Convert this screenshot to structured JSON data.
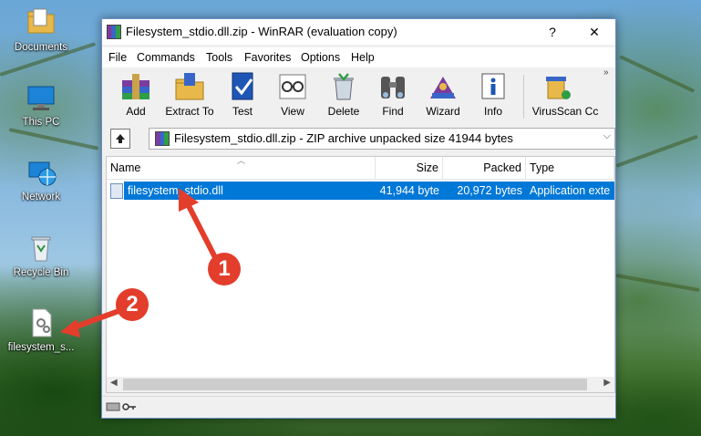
{
  "desktop": {
    "icons": [
      {
        "label": "Documents",
        "icon": "folder-icon"
      },
      {
        "label": "This PC",
        "icon": "monitor-icon"
      },
      {
        "label": "Network",
        "icon": "network-globe-icon"
      },
      {
        "label": "Recycle Bin",
        "icon": "recycle-bin-icon"
      },
      {
        "label": "filesystem_s...",
        "icon": "dll-file-icon"
      }
    ]
  },
  "window": {
    "title": "Filesystem_stdio.dll.zip - WinRAR (evaluation copy)",
    "help_button": "?",
    "close_button": "✕"
  },
  "menu": [
    "File",
    "Commands",
    "Tools",
    "Favorites",
    "Options",
    "Help"
  ],
  "toolbar": {
    "buttons": [
      {
        "label": "Add",
        "icon": "books-add-icon"
      },
      {
        "label": "Extract To",
        "icon": "folder-extract-icon"
      },
      {
        "label": "Test",
        "icon": "test-check-icon"
      },
      {
        "label": "View",
        "icon": "glasses-book-icon"
      },
      {
        "label": "Delete",
        "icon": "delete-bin-icon"
      },
      {
        "label": "Find",
        "icon": "binoculars-icon"
      },
      {
        "label": "Wizard",
        "icon": "wizard-icon"
      },
      {
        "label": "Info",
        "icon": "info-icon"
      },
      {
        "label": "VirusScan",
        "icon": "virusscan-icon"
      },
      {
        "label": "Cc",
        "icon": "comment-icon"
      }
    ],
    "overflow": "»"
  },
  "address": {
    "path": "Filesystem_stdio.dll.zip - ZIP archive unpacked size 41944 bytes",
    "dropdown": "⌵"
  },
  "columns": [
    "Name",
    "Size",
    "Packed",
    "Type"
  ],
  "files": [
    {
      "name": "filesystem_stdio.dll",
      "size": "41,944 byte",
      "packed": "20,972 bytes",
      "type": "Application exte"
    }
  ],
  "annotations": [
    "1",
    "2"
  ],
  "colors": {
    "selection": "#0078d7",
    "annotation": "#e33d2c",
    "window_border": "#6a8fc4"
  }
}
